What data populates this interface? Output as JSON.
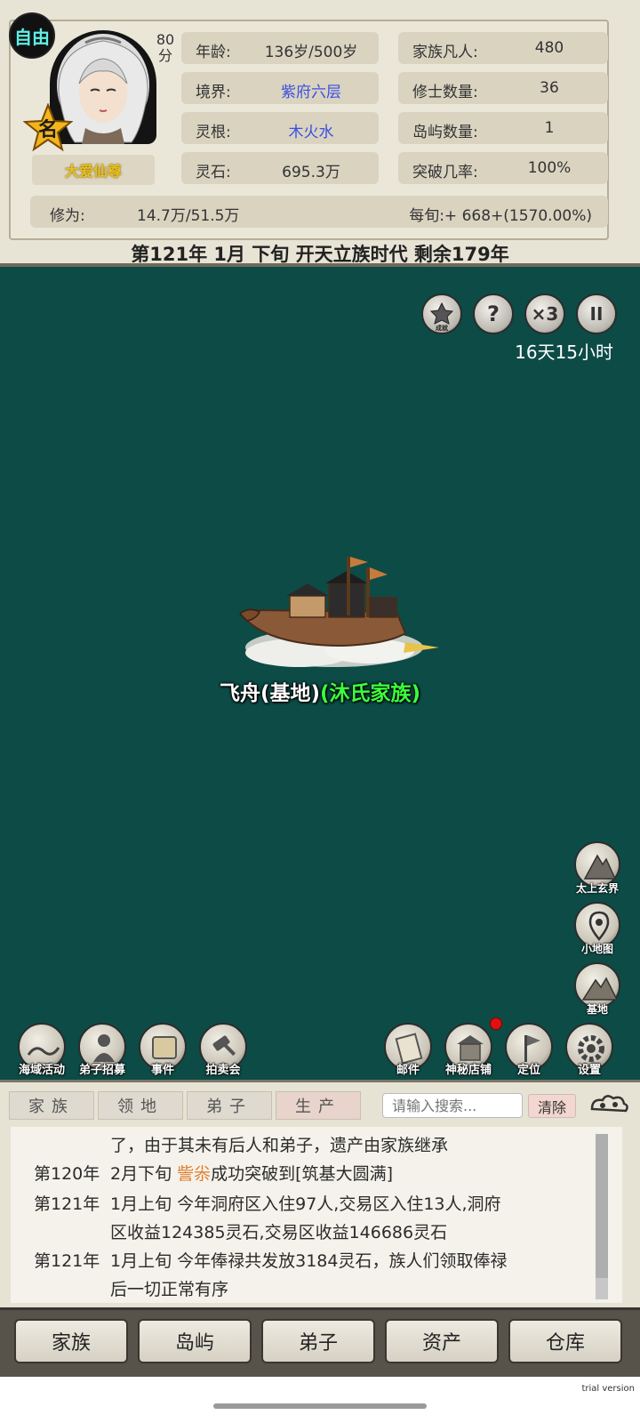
{
  "header": {
    "mode_badge": "自由",
    "score_value": "80",
    "score_unit": "分",
    "name_badge": "名",
    "title": "大爱仙尊",
    "stats": [
      {
        "key": "年龄:",
        "value": "136岁/500岁",
        "color": "normal"
      },
      {
        "key": "境界:",
        "value": "紫府六层",
        "color": "blue"
      },
      {
        "key": "灵根:",
        "value": "木火水",
        "color": "blue"
      },
      {
        "key": "灵石:",
        "value": "695.3万",
        "color": "normal"
      },
      {
        "key": "家族凡人:",
        "value": "480",
        "color": "normal"
      },
      {
        "key": "修士数量:",
        "value": "36",
        "color": "normal"
      },
      {
        "key": "岛屿数量:",
        "value": "1",
        "color": "normal"
      },
      {
        "key": "突破几率:",
        "value": "100%",
        "color": "normal"
      }
    ],
    "cultivation_label": "修为:",
    "cultivation_value": "14.7万/51.5万",
    "per_period": "每旬:+ 668+(1570.00%)",
    "timeline": "第121年 1月 下旬  开天立族时代 剩余179年"
  },
  "map": {
    "achievement_label": "成就",
    "help_label": "?",
    "speed_label": "×3",
    "pause_label": "II",
    "timer": "16天15小时",
    "ship_label_base": "飞舟(基地)",
    "ship_label_family": "(沐氏家族)"
  },
  "side_buttons": [
    {
      "label": "太上玄界"
    },
    {
      "label": "小地图"
    },
    {
      "label": "基地"
    }
  ],
  "bottom_buttons_left": [
    {
      "label": "海域活动"
    },
    {
      "label": "弟子招募"
    },
    {
      "label": "事件"
    },
    {
      "label": "拍卖会"
    }
  ],
  "bottom_buttons_right": [
    {
      "label": "邮件"
    },
    {
      "label": "神秘店铺"
    },
    {
      "label": "定位"
    },
    {
      "label": "设置"
    }
  ],
  "log": {
    "tabs": [
      "家族",
      "领地",
      "弟子",
      "生产"
    ],
    "active_tab": "生产",
    "search_placeholder": "请输入搜索...",
    "clear_label": "清除",
    "entries": [
      {
        "year": "",
        "lines": [
          "了，由于其未有后人和弟子，遗产由家族继承"
        ]
      },
      {
        "year": "第120年",
        "lines": [
          "2月下旬 ",
          "訾尜",
          "成功突破到[筑基大圆满]"
        ]
      },
      {
        "year": "第121年",
        "lines": [
          "1月上旬 今年洞府区入住97人,交易区入住13人,洞府",
          "区收益124385灵石,交易区收益146686灵石"
        ]
      },
      {
        "year": "第121年",
        "lines": [
          "1月上旬 今年俸禄共发放3184灵石，族人们领取俸禄",
          "后一切正常有序"
        ]
      }
    ]
  },
  "bottom_nav": [
    "家族",
    "岛屿",
    "弟子",
    "资产",
    "仓库"
  ],
  "watermark": "trial version"
}
